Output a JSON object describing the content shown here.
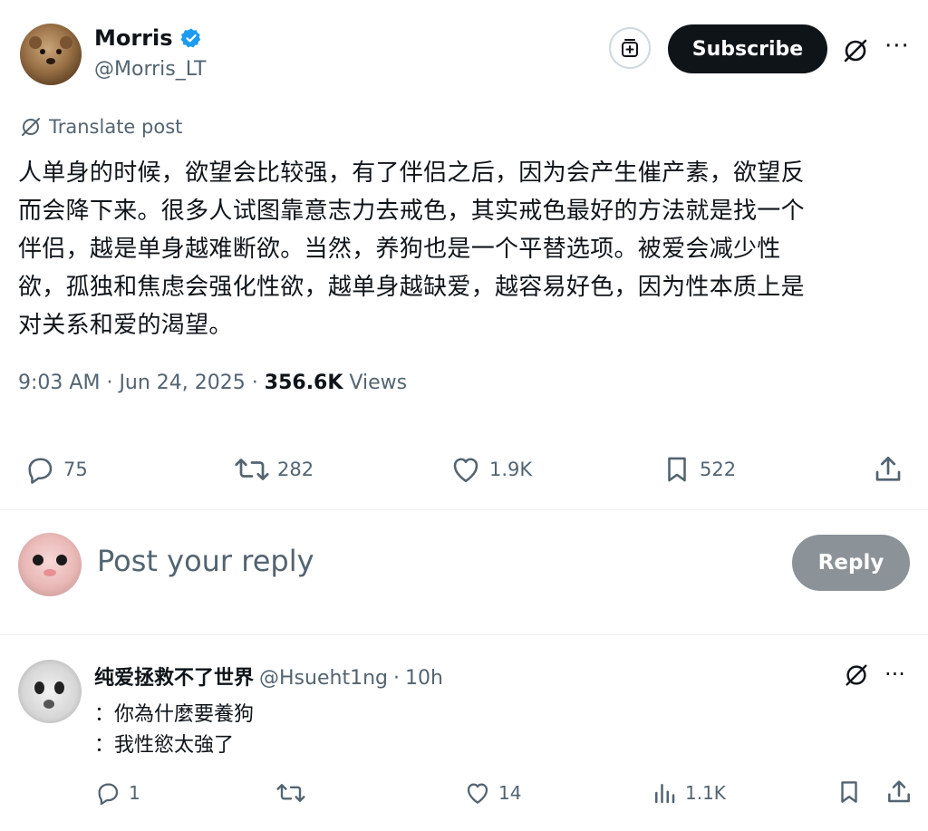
{
  "post": {
    "author_name": "Morris",
    "author_handle": "@Morris_LT",
    "subscribe_label": "Subscribe",
    "more_label": "···",
    "translate_label": "Translate post",
    "text_lines": [
      "人单身的时候，欲望会比较强，有了伴侣之后，因为会产生催产素，欲望反",
      "而会降下来。很多人试图靠意志力去戒色，其实戒色最好的方法就是找一个",
      "伴侣，越是单身越难断欲。当然，养狗也是一个平替选项。被爱会减少性",
      "欲，孤独和焦虑会强化性欲，越单身越缺爱，越容易好色，因为性本质上是",
      "对关系和爱的渴望。"
    ],
    "time": "9:03 AM",
    "date": "Jun 24, 2025",
    "views_count": "356.6K",
    "views_label": "Views",
    "separator": "·",
    "stats": {
      "replies": "75",
      "reposts": "282",
      "likes": "1.9K",
      "bookmarks": "522"
    }
  },
  "composer": {
    "placeholder": "Post your reply",
    "reply_label": "Reply"
  },
  "comment": {
    "name": "纯爱拯救不了世界",
    "handle": "@Hsueht1ng",
    "dot": "·",
    "age": "10h",
    "more_label": "···",
    "lines": [
      "：你為什麼要養狗",
      "：我性慾太強了"
    ],
    "stats": {
      "replies": "1",
      "likes": "14",
      "views": "1.1K"
    }
  },
  "colors": {
    "text": "#0f1419",
    "secondary": "#536471",
    "verified": "#1d9bf0",
    "reply_button": "#8b9298"
  },
  "icons": [
    "verified-badge-icon",
    "subscription-icon",
    "grok-icon",
    "more-icon",
    "translate-icon",
    "reply-icon",
    "repost-icon",
    "like-icon",
    "bookmark-icon",
    "share-icon",
    "views-icon"
  ]
}
